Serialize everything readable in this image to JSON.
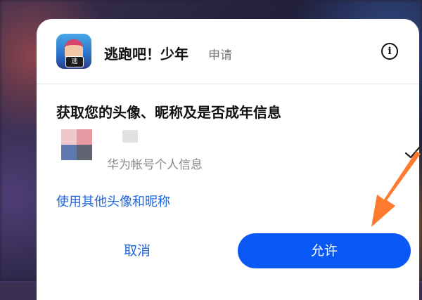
{
  "dialog": {
    "app_name": "逃跑吧！少年",
    "header_suffix": "申请",
    "app_icon_badge": "逃",
    "info_icon": "info-icon",
    "scope_title": "获取您的头像、昵称及是否成年信息",
    "account": {
      "caption": "华为帐号个人信息",
      "selected": true,
      "check_icon": "check-icon"
    },
    "alt_link": "使用其他头像和昵称",
    "buttons": {
      "cancel": "取消",
      "allow": "允许"
    }
  },
  "annotation": {
    "arrow_icon": "pointer-arrow-icon",
    "color": "#ff7a2e"
  },
  "colors": {
    "accent": "#0a59f7",
    "link": "#1f66e0"
  }
}
